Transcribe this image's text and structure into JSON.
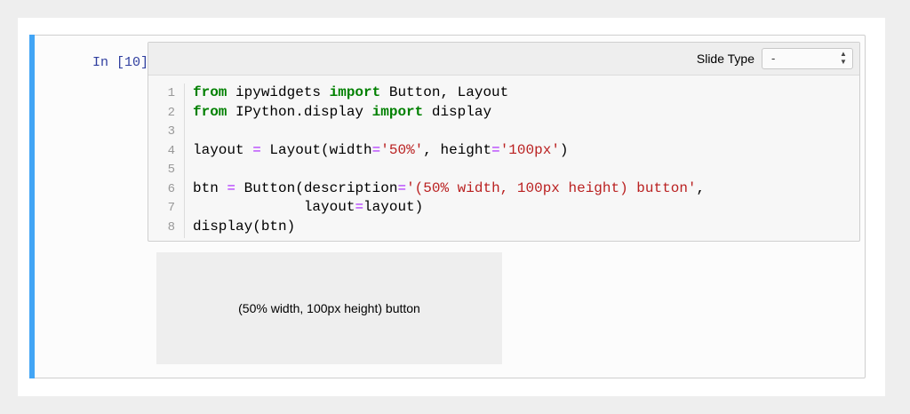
{
  "cell": {
    "prompt": "In [10]:",
    "toolbar": {
      "label": "Slide Type",
      "select_value": "-"
    },
    "code_lines": [
      {
        "n": "1",
        "tokens": [
          {
            "t": "from",
            "c": "kw"
          },
          {
            "t": " ipywidgets ",
            "c": ""
          },
          {
            "t": "import",
            "c": "kw"
          },
          {
            "t": " Button, Layout",
            "c": ""
          }
        ]
      },
      {
        "n": "2",
        "tokens": [
          {
            "t": "from",
            "c": "kw"
          },
          {
            "t": " IPython.display ",
            "c": ""
          },
          {
            "t": "import",
            "c": "kw"
          },
          {
            "t": " display",
            "c": ""
          }
        ]
      },
      {
        "n": "3",
        "tokens": []
      },
      {
        "n": "4",
        "tokens": [
          {
            "t": "layout ",
            "c": ""
          },
          {
            "t": "=",
            "c": "op"
          },
          {
            "t": " Layout(width",
            "c": ""
          },
          {
            "t": "=",
            "c": "op"
          },
          {
            "t": "'50%'",
            "c": "str"
          },
          {
            "t": ", height",
            "c": ""
          },
          {
            "t": "=",
            "c": "op"
          },
          {
            "t": "'100px'",
            "c": "str"
          },
          {
            "t": ")",
            "c": ""
          }
        ]
      },
      {
        "n": "5",
        "tokens": []
      },
      {
        "n": "6",
        "tokens": [
          {
            "t": "btn ",
            "c": ""
          },
          {
            "t": "=",
            "c": "op"
          },
          {
            "t": " Button(description",
            "c": ""
          },
          {
            "t": "=",
            "c": "op"
          },
          {
            "t": "'(50% width, 100px height) button'",
            "c": "str"
          },
          {
            "t": ",",
            "c": ""
          }
        ]
      },
      {
        "n": "7",
        "tokens": [
          {
            "t": "             layout",
            "c": ""
          },
          {
            "t": "=",
            "c": "op"
          },
          {
            "t": "layout)",
            "c": ""
          }
        ]
      },
      {
        "n": "8",
        "tokens": [
          {
            "t": "display(btn)",
            "c": ""
          }
        ]
      }
    ],
    "output": {
      "button_label": "(50% width, 100px height) button"
    }
  },
  "colors": {
    "accent": "#42a5f5",
    "keyword": "#008000",
    "string": "#ba2121",
    "operator": "#aa22ff",
    "prompt": "#303f9f"
  }
}
